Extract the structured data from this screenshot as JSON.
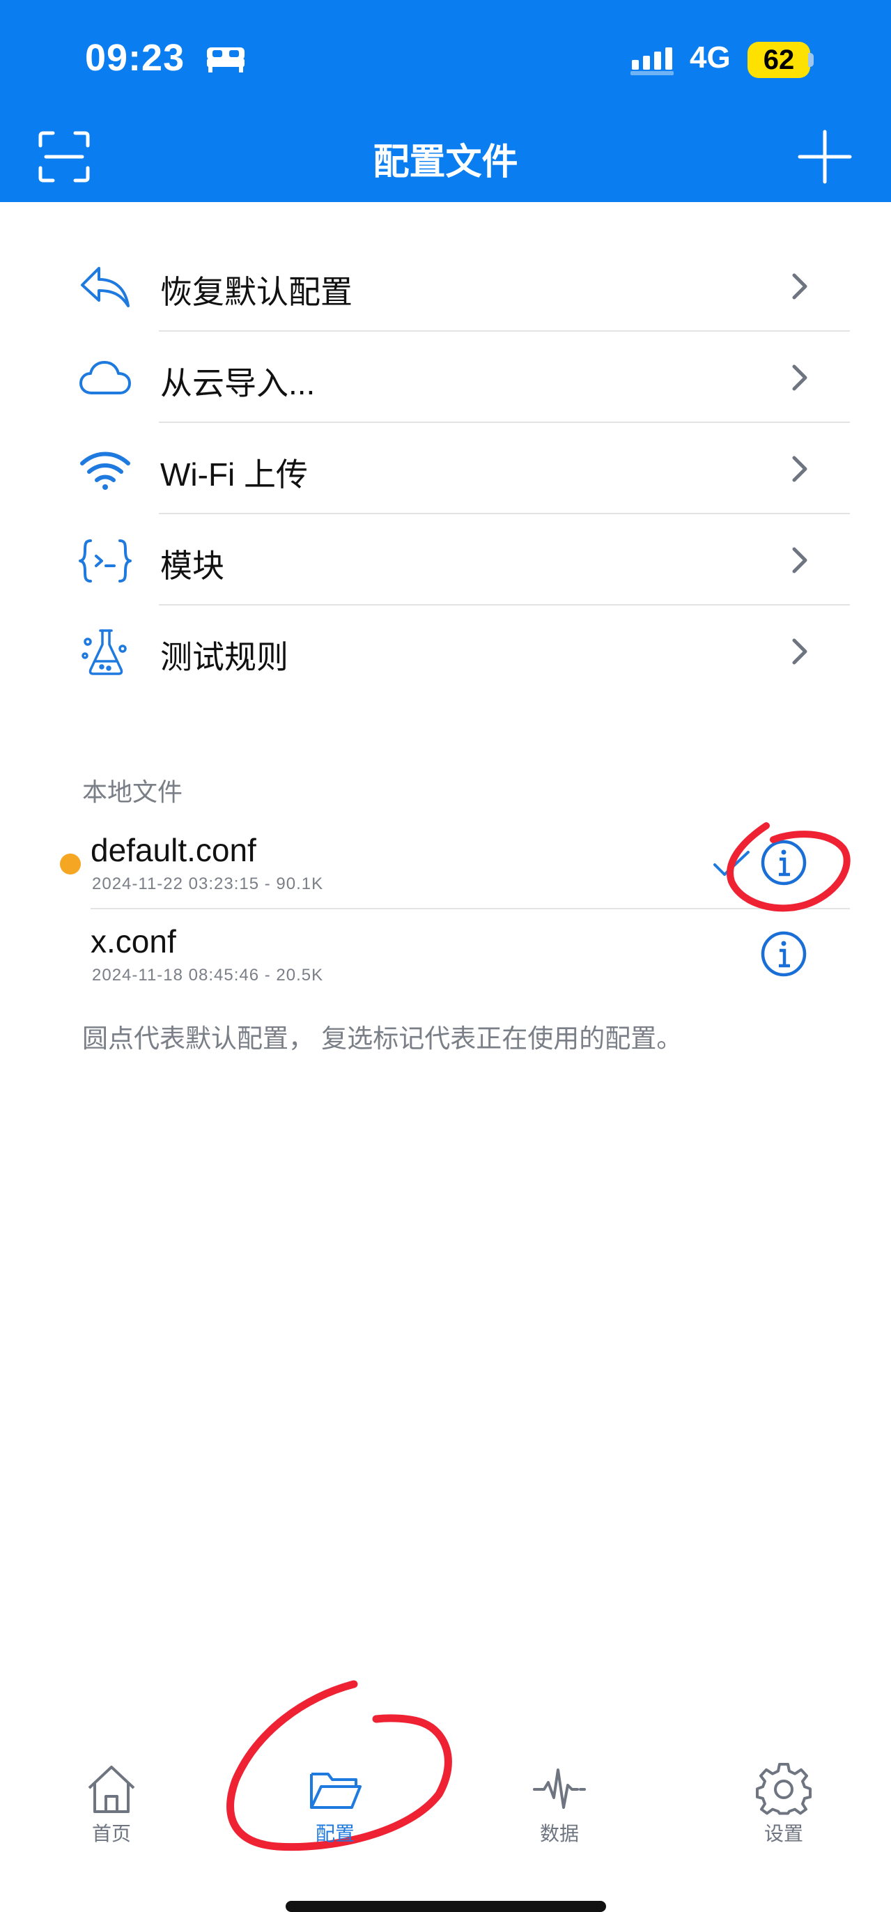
{
  "status_bar": {
    "time": "09:23",
    "network": "4G",
    "battery": "62"
  },
  "header": {
    "title": "配置文件"
  },
  "menu": {
    "items": [
      {
        "label": "恢复默认配置",
        "icon": "undo-arrow-icon"
      },
      {
        "label": "从云导入...",
        "icon": "cloud-icon"
      },
      {
        "label": "Wi-Fi 上传",
        "icon": "wifi-icon"
      },
      {
        "label": "模块",
        "icon": "module-braces-icon"
      },
      {
        "label": "测试规则",
        "icon": "flask-icon"
      }
    ]
  },
  "local_files": {
    "header": "本地文件",
    "files": [
      {
        "name": "default.conf",
        "meta": "2024-11-22 03:23:15 - 90.1K",
        "is_default": true,
        "in_use": true
      },
      {
        "name": "x.conf",
        "meta": "2024-11-18 08:45:46 - 20.5K",
        "is_default": false,
        "in_use": false
      }
    ],
    "footnote": "圆点代表默认配置， 复选标记代表正在使用的配置。"
  },
  "tabbar": {
    "tabs": [
      {
        "label": "首页",
        "icon": "home-icon",
        "active": false
      },
      {
        "label": "配置",
        "icon": "folder-icon",
        "active": true
      },
      {
        "label": "数据",
        "icon": "activity-icon",
        "active": false
      },
      {
        "label": "设置",
        "icon": "gear-icon",
        "active": false
      }
    ]
  },
  "colors": {
    "header_bg": "#0a7ef0",
    "accent": "#1f7ae0",
    "default_dot": "#f5a623",
    "annotation": "#ee2233",
    "battery": "#ffe100"
  }
}
